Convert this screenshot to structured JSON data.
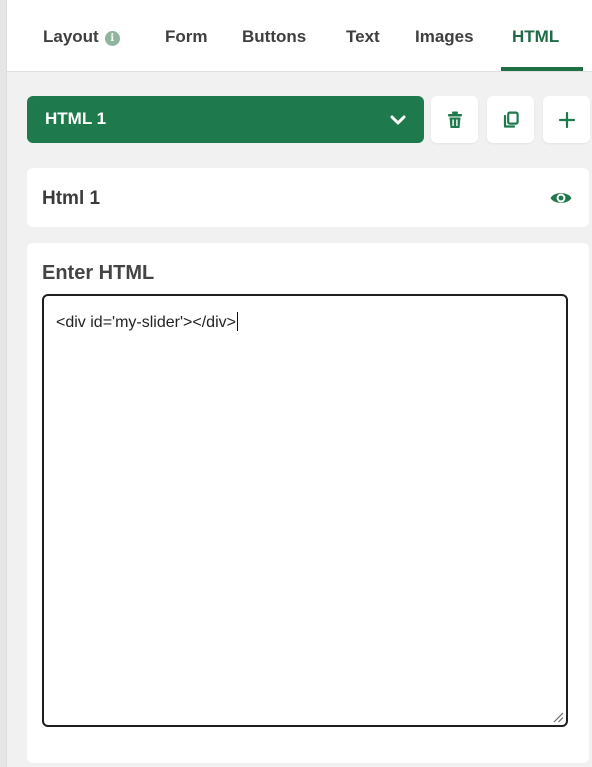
{
  "tabs": [
    {
      "label": "Layout",
      "active": false,
      "info_icon": "info-icon"
    },
    {
      "label": "Form",
      "active": false
    },
    {
      "label": "Buttons",
      "active": false
    },
    {
      "label": "Text",
      "active": false
    },
    {
      "label": "Images",
      "active": false
    },
    {
      "label": "HTML",
      "active": true
    }
  ],
  "selector": {
    "value": "HTML 1",
    "icon": "chevron-down-icon",
    "actions": [
      "trash-icon",
      "duplicate-icon",
      "plus-icon"
    ]
  },
  "item": {
    "name": "Html 1",
    "visibility_icon": "eye-icon"
  },
  "editor": {
    "label": "Enter HTML",
    "value": "<div id='my-slider'></div>"
  },
  "colors": {
    "accent": "#1e7a4d",
    "active_tab": "#1f6b45",
    "background": "#f1f1f1",
    "card": "#ffffff"
  }
}
